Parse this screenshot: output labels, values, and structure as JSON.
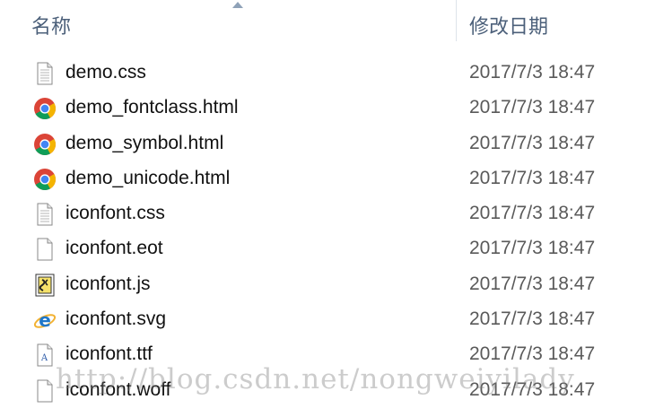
{
  "header": {
    "name_label": "名称",
    "date_label": "修改日期"
  },
  "files": [
    {
      "name": "demo.css",
      "date": "2017/7/3 18:47",
      "icon": "text-file-icon"
    },
    {
      "name": "demo_fontclass.html",
      "date": "2017/7/3 18:47",
      "icon": "chrome-icon"
    },
    {
      "name": "demo_symbol.html",
      "date": "2017/7/3 18:47",
      "icon": "chrome-icon"
    },
    {
      "name": "demo_unicode.html",
      "date": "2017/7/3 18:47",
      "icon": "chrome-icon"
    },
    {
      "name": "iconfont.css",
      "date": "2017/7/3 18:47",
      "icon": "text-file-icon"
    },
    {
      "name": "iconfont.eot",
      "date": "2017/7/3 18:47",
      "icon": "blank-file-icon"
    },
    {
      "name": "iconfont.js",
      "date": "2017/7/3 18:47",
      "icon": "script-file-icon"
    },
    {
      "name": "iconfont.svg",
      "date": "2017/7/3 18:47",
      "icon": "ie-icon"
    },
    {
      "name": "iconfont.ttf",
      "date": "2017/7/3 18:47",
      "icon": "font-file-icon"
    },
    {
      "name": "iconfont.woff",
      "date": "2017/7/3 18:47",
      "icon": "blank-file-icon"
    }
  ],
  "watermark": "http://blog.csdn.net/nongweiyilady"
}
